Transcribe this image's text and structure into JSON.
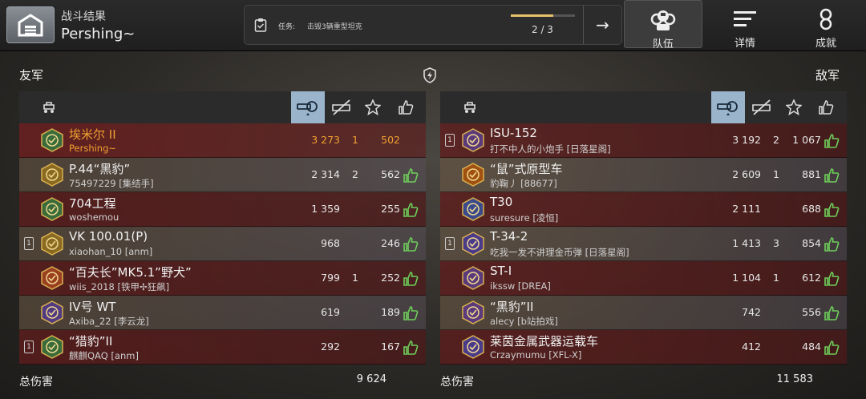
{
  "header": {
    "subtitle": "战斗结果",
    "title": "Pershing~"
  },
  "mission": {
    "label": "任务:",
    "text": "击毁3辆重型坦克",
    "count": "2 / 3",
    "progress": 0.667
  },
  "tabs": [
    {
      "label": "队伍",
      "icon": "team-icon",
      "active": true
    },
    {
      "label": "详情",
      "icon": "details-icon",
      "active": false
    },
    {
      "label": "成就",
      "icon": "achievements-icon",
      "active": false
    }
  ],
  "allies": {
    "label": "友军",
    "total_label": "总伤害",
    "total": "9 624",
    "rows": [
      {
        "tank": "埃米尔 II",
        "player": "Pershing~",
        "damage": "3 273",
        "kills": "1",
        "exp": "502",
        "platoon": false,
        "me": true,
        "liked": false,
        "badge_color": "#3a6b3a"
      },
      {
        "tank": "P.44“黑豹”",
        "player": "75497229 [集结手]",
        "damage": "2 314",
        "kills": "2",
        "exp": "562",
        "platoon": false,
        "me": false,
        "liked": true,
        "badge_color": "#8a6a20"
      },
      {
        "tank": "704工程",
        "player": "woshemou",
        "damage": "1 359",
        "kills": "",
        "exp": "255",
        "platoon": false,
        "me": false,
        "liked": true,
        "badge_color": "#3a6b3a"
      },
      {
        "tank": "VK 100.01(P)",
        "player": "xiaohan_10 [anm]",
        "damage": "968",
        "kills": "",
        "exp": "246",
        "platoon": true,
        "me": false,
        "liked": true,
        "badge_color": "#8a6a20"
      },
      {
        "tank": "“百夫长”MK5.1”野犬”",
        "player": "wiis_2018 [铁甲✢狂飙]",
        "damage": "799",
        "kills": "1",
        "exp": "252",
        "platoon": false,
        "me": false,
        "liked": true,
        "badge_color": "#9a4020"
      },
      {
        "tank": "IV号 WT",
        "player": "Axiba_22 [李云龙]",
        "damage": "619",
        "kills": "",
        "exp": "189",
        "platoon": false,
        "me": false,
        "liked": true,
        "badge_color": "#503a80"
      },
      {
        "tank": "“猎豹”II",
        "player": "麒麒QAQ [anm]",
        "damage": "292",
        "kills": "",
        "exp": "167",
        "platoon": true,
        "me": false,
        "liked": true,
        "badge_color": "#3a6b3a"
      }
    ]
  },
  "enemies": {
    "label": "敌军",
    "total_label": "总伤害",
    "total": "11 583",
    "rows": [
      {
        "tank": "ISU-152",
        "player": "打不中人的小炮手 [日落星阁]",
        "damage": "3 192",
        "kills": "2",
        "exp": "1 067",
        "platoon": true,
        "liked": true,
        "badge_color": "#5a3a7a"
      },
      {
        "tank": "“鼠”式原型车",
        "player": "豹鞠丿 [88677]",
        "damage": "2 609",
        "kills": "1",
        "exp": "881",
        "platoon": false,
        "liked": true,
        "badge_color": "#a05010"
      },
      {
        "tank": "T30",
        "player": "suresure [凌恒]",
        "damage": "2 111",
        "kills": "",
        "exp": "688",
        "platoon": false,
        "liked": true,
        "badge_color": "#3a4a8a"
      },
      {
        "tank": "T-34-2",
        "player": "吃我一发不讲理金币弹 [日落星阁]",
        "damage": "1 413",
        "kills": "3",
        "exp": "854",
        "platoon": true,
        "liked": true,
        "badge_color": "#4a3a8a"
      },
      {
        "tank": "ST-I",
        "player": "ikssw [DREA]",
        "damage": "1 104",
        "kills": "1",
        "exp": "612",
        "platoon": false,
        "liked": true,
        "badge_color": "#5a3a7a"
      },
      {
        "tank": "“黑豹”II",
        "player": "alecy [b站拍戏]",
        "damage": "742",
        "kills": "",
        "exp": "556",
        "platoon": false,
        "liked": true,
        "badge_color": "#5a3a7a"
      },
      {
        "tank": "莱茵金属武器运载车",
        "player": "Crzaymumu [XFL-X]",
        "damage": "412",
        "kills": "",
        "exp": "484",
        "platoon": false,
        "liked": true,
        "badge_color": "#4a3a8a"
      }
    ]
  }
}
